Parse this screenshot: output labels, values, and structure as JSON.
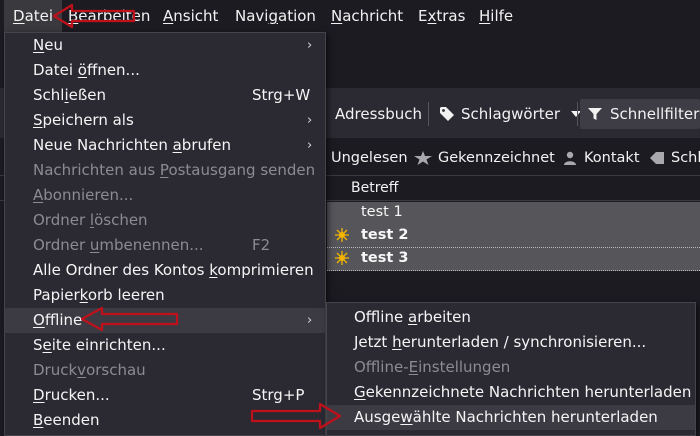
{
  "menubar": {
    "items": [
      {
        "pre": "",
        "acc": "D",
        "post": "atei"
      },
      {
        "pre": "",
        "acc": "B",
        "post": "earbeiten"
      },
      {
        "pre": "",
        "acc": "A",
        "post": "nsicht"
      },
      {
        "pre": "Navi",
        "acc": "g",
        "post": "ation"
      },
      {
        "pre": "",
        "acc": "N",
        "post": "achricht"
      },
      {
        "pre": "E",
        "acc": "x",
        "post": "tras"
      },
      {
        "pre": "",
        "acc": "H",
        "post": "ilfe"
      }
    ]
  },
  "toolbar": {
    "address_book": "Adressbuch",
    "tags": "Schlagwörter",
    "quick_filter": "Schnellfilter"
  },
  "filterbar": {
    "unread": "Ungelesen",
    "starred": "Gekennzeichnet",
    "contact": "Kontakt",
    "tags": "Schl"
  },
  "message_list": {
    "subject_header": "Betreff",
    "rows": [
      {
        "subject": "test 1"
      },
      {
        "subject": "test 2"
      },
      {
        "subject": "test 3"
      }
    ]
  },
  "file_menu": {
    "items": [
      {
        "pre": "",
        "acc": "N",
        "post": "eu",
        "shortcut": ""
      },
      {
        "pre": "Datei ",
        "acc": "ö",
        "post": "ffnen...",
        "shortcut": ""
      },
      {
        "pre": "Schl",
        "acc": "i",
        "post": "eßen",
        "shortcut": "Strg+W"
      },
      {
        "pre": "",
        "acc": "S",
        "post": "peichern als",
        "shortcut": ""
      },
      {
        "pre": "Neue Nachrichten ",
        "acc": "a",
        "post": "brufen",
        "shortcut": ""
      },
      {
        "pre": "Nachrichten aus ",
        "acc": "P",
        "post": "ostausgang senden",
        "shortcut": ""
      },
      {
        "pre": "",
        "acc": "A",
        "post": "bonnieren...",
        "shortcut": ""
      },
      {
        "pre": "Ordner ",
        "acc": "l",
        "post": "öschen",
        "shortcut": ""
      },
      {
        "pre": "Ordner ",
        "acc": "u",
        "post": "mbenennen...",
        "shortcut": "F2"
      },
      {
        "pre": "Alle Ordner des Kontos ",
        "acc": "k",
        "post": "omprimieren",
        "shortcut": ""
      },
      {
        "pre": "Papier",
        "acc": "k",
        "post": "orb leeren",
        "shortcut": ""
      },
      {
        "pre": "",
        "acc": "O",
        "post": "ffline",
        "shortcut": ""
      },
      {
        "pre": "S",
        "acc": "e",
        "post": "ite einrichten...",
        "shortcut": ""
      },
      {
        "pre": "Druck",
        "acc": "v",
        "post": "orschau",
        "shortcut": ""
      },
      {
        "pre": "",
        "acc": "D",
        "post": "rucken...",
        "shortcut": "Strg+P"
      },
      {
        "pre": "",
        "acc": "B",
        "post": "eenden",
        "shortcut": ""
      }
    ]
  },
  "offline_menu": {
    "items": [
      {
        "pre": "Offline ",
        "acc": "a",
        "post": "rbeiten"
      },
      {
        "pre": "Jetzt ",
        "acc": "h",
        "post": "erunterladen / synchronisieren..."
      },
      {
        "pre": "Offline-",
        "acc": "E",
        "post": "instellungen"
      },
      {
        "pre": "",
        "acc": "G",
        "post": "ekennzeichnete Nachrichten herunterladen"
      },
      {
        "pre": "Ausge",
        "acc": "w",
        "post": "ählte Nachrichten herunterladen"
      }
    ]
  }
}
